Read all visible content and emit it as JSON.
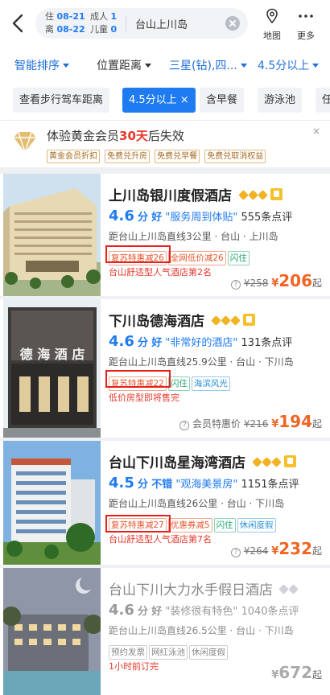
{
  "search": {
    "checkin_label": "住",
    "checkin_date": "08-21",
    "checkout_label": "离",
    "checkout_date": "08-22",
    "adults_label": "成人",
    "adults": "1",
    "children_label": "儿童",
    "children": "0",
    "keyword": "台山上川岛"
  },
  "nav": {
    "map_label": "地图",
    "more_label": "更多"
  },
  "sorts": [
    "智能排序",
    "位置距离",
    "三星(钻),四...",
    "4.5分以上"
  ],
  "chips": [
    "查看步行驾车距离",
    "4.5分以上 ×",
    "含早餐",
    "游泳池",
    "任"
  ],
  "promo": {
    "title_prefix": "体验黄金会员",
    "title_days": "30天",
    "title_suffix": "后失效",
    "tags": [
      "黄金会员折扣",
      "免费兑升房",
      "免费兑早餐",
      "免费兑取消权益"
    ],
    "close": "×"
  },
  "hotels": [
    {
      "name": "上川岛银川度假酒店",
      "score": "4.6",
      "score_unit": "分",
      "word": "好",
      "quote": "\"服务周到体贴\"",
      "reviews": "555条点评",
      "distance": "距台山上川岛直线3公里 · 台山 · 上川岛",
      "tags": [
        "复苏特惠减26",
        "全网低价减26",
        "闪住"
      ],
      "note": "台山舒适型人气酒店第2名",
      "orig": "¥258",
      "currency": "¥",
      "price": "206",
      "suffix": "起"
    },
    {
      "name": "下川岛德海酒店",
      "score": "4.6",
      "score_unit": "分",
      "word": "好",
      "quote": "\"非常好的酒店\"",
      "reviews": "131条点评",
      "distance": "距台山上川岛直线25.9公里 · 台山 · 下川岛",
      "tags": [
        "复苏特惠减22",
        "闪住",
        "海滨风光"
      ],
      "note": "低价房型即将售完",
      "price_prefix": "会员特惠价",
      "orig": "¥216",
      "currency": "¥",
      "price": "194",
      "suffix": "起",
      "sign_text": "德 海 酒 店"
    },
    {
      "name": "台山下川岛星海湾酒店",
      "score": "4.5",
      "score_unit": "分",
      "word": "不错",
      "quote": "\"观海美景房\"",
      "reviews": "1151条点评",
      "distance": "距台山上川岛直线26公里 · 台山 · 下川岛",
      "tags": [
        "复苏特惠减27",
        "优惠券减5",
        "闪住",
        "休闲度假"
      ],
      "note": "台山舒适型人气酒店第7名",
      "orig": "¥264",
      "currency": "¥",
      "price": "232",
      "suffix": "起"
    },
    {
      "name": "台山下川大力水手假日酒店",
      "score": "4.6",
      "score_unit": "分",
      "word": "好",
      "quote": "\"装修很有特色\"",
      "reviews": "1040条点评",
      "distance": "距台山上川岛直线26.5公里 · 台山 · 下川岛",
      "tags": [
        "预约发票",
        "网红泳池",
        "休闲度假"
      ],
      "note": "1小时前订完",
      "currency": "¥",
      "price": "672",
      "suffix": "起"
    }
  ]
}
